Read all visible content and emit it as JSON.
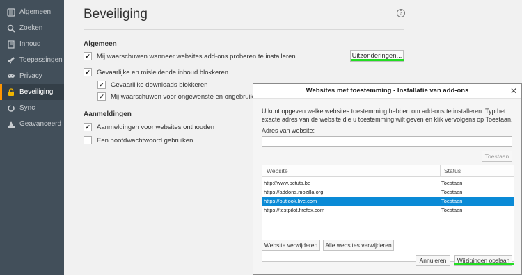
{
  "sidebar": {
    "items": [
      {
        "label": "Algemeen",
        "icon": "menu-lines-icon"
      },
      {
        "label": "Zoeken",
        "icon": "search-icon"
      },
      {
        "label": "Inhoud",
        "icon": "document-icon"
      },
      {
        "label": "Toepassingen",
        "icon": "rocket-icon"
      },
      {
        "label": "Privacy",
        "icon": "mask-icon"
      },
      {
        "label": "Beveiliging",
        "icon": "lock-icon"
      },
      {
        "label": "Sync",
        "icon": "sync-icon"
      },
      {
        "label": "Geavanceerd",
        "icon": "wizard-hat-icon"
      }
    ],
    "active": "Beveiliging",
    "accent": "#ff9500"
  },
  "main": {
    "title": "Beveiliging",
    "general_heading": "Algemeen",
    "general_options": [
      {
        "label": "Mij waarschuwen wanneer websites add-ons proberen te installeren",
        "checked": true
      },
      {
        "label": "Gevaarlijke en misleidende inhoud blokkeren",
        "checked": true
      },
      {
        "label": "Gevaarlijke downloads blokkeren",
        "checked": true
      },
      {
        "label": "Mij waarschuwen voor ongewenste en ongebruikelijke",
        "checked": true
      }
    ],
    "exceptions_button": "Uitzonderingen...",
    "logins_heading": "Aanmeldingen",
    "login_options": [
      {
        "label": "Aanmeldingen voor websites onthouden",
        "checked": true
      },
      {
        "label": "Een hoofdwachtwoord gebruiken",
        "checked": false
      }
    ]
  },
  "dialog": {
    "title": "Websites met toestemming - Installatie van add-ons",
    "close_glyph": "✕",
    "description": "U kunt opgeven welke websites toestemming hebben om add-ons te installeren. Typ het exacte adres van de website die u toestemming wilt geven en klik vervolgens op Toestaan.",
    "address_label": "Adres van website:",
    "address_value": "",
    "allow_button": "Toestaan",
    "columns": [
      "Website",
      "Status"
    ],
    "rows": [
      {
        "website": "http://www.pctuts.be",
        "status": "Toestaan"
      },
      {
        "website": "https://addons.mozilla.org",
        "status": "Toestaan"
      },
      {
        "website": "https://outlook.live.com",
        "status": "Toestaan"
      },
      {
        "website": "https://testpilot.firefox.com",
        "status": "Toestaan"
      }
    ],
    "selected_row": 2,
    "selection_color": "#0a8ad6",
    "remove_button": "Website verwijderen",
    "remove_all_button": "Alle websites verwijderen",
    "cancel_button": "Annuleren",
    "save_button": "Wijzigingen opslaan"
  },
  "highlight_color": "#22dd22"
}
